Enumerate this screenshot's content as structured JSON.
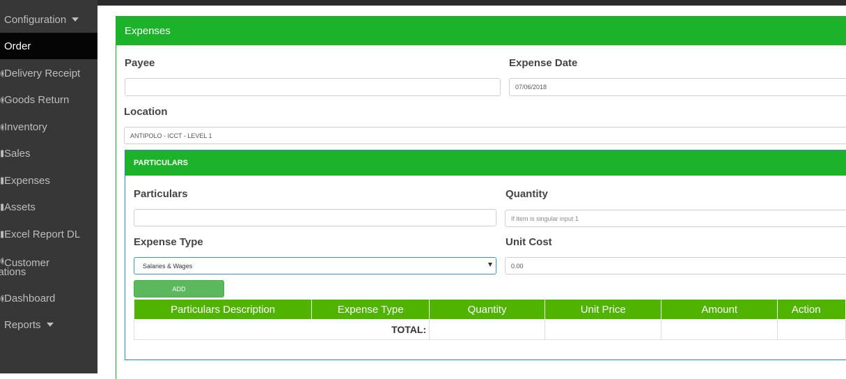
{
  "sidebar": {
    "items": [
      {
        "label": "Configuration",
        "caret": true
      },
      {
        "label": "Order",
        "active": true
      },
      {
        "label": "Delivery Receipt"
      },
      {
        "label": "Goods Return"
      },
      {
        "label": "Inventory"
      },
      {
        "label": "Sales"
      },
      {
        "label": "Expenses"
      },
      {
        "label": "Assets"
      },
      {
        "label": "Excel Report DL"
      },
      {
        "line1": "Customer",
        "line2": "lations"
      },
      {
        "label": "Dashboard"
      },
      {
        "label": "Reports",
        "caret": true
      }
    ]
  },
  "expenses": {
    "title": "Expenses",
    "payee_label": "Payee",
    "payee_value": "",
    "date_label": "Expense Date",
    "date_value": "07/06/2018",
    "location_label": "Location",
    "location_value": "ANTIPOLO - ICCT - LEVEL 1"
  },
  "particulars": {
    "title": "PARTICULARS",
    "particulars_label": "Particulars",
    "particulars_value": "",
    "quantity_label": "Quantity",
    "quantity_placeholder": "If item is singular input 1",
    "expense_type_label": "Expense Type",
    "expense_type_selected": "Salaries & Wages",
    "unit_cost_label": "Unit Cost",
    "unit_cost_value": "0.00",
    "add_label": "ADD"
  },
  "table": {
    "headers": [
      "Particulars Description",
      "Expense Type",
      "Quantity",
      "Unit Price",
      "Amount",
      "Action"
    ],
    "total_label": "TOTAL:"
  },
  "colors": {
    "sidebar_bg": "#373737",
    "header_green": "#1cb32a",
    "table_header_green": "#4fb300",
    "add_button": "#5cb85c"
  }
}
